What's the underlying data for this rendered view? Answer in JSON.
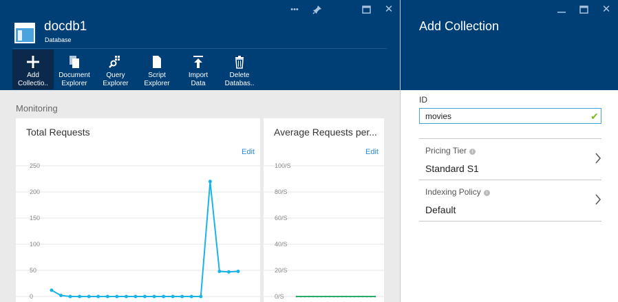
{
  "database_blade": {
    "title": "docdb1",
    "subtitle": "Database",
    "window_controls": [
      {
        "name": "more-icon",
        "glyph": "•••"
      },
      {
        "name": "pin-icon",
        "glyph": "📌"
      },
      {
        "name": "maximize-icon",
        "glyph": "□"
      },
      {
        "name": "close-icon",
        "glyph": "✕"
      }
    ],
    "toolbar": [
      {
        "label": "Add\nCollectio..",
        "icon": "plus-icon"
      },
      {
        "label": "Document\nExplorer",
        "icon": "documents-icon"
      },
      {
        "label": "Query\nExplorer",
        "icon": "query-icon"
      },
      {
        "label": "Script\nExplorer",
        "icon": "script-icon"
      },
      {
        "label": "Import\nData",
        "icon": "import-icon"
      },
      {
        "label": "Delete\nDatabas..",
        "icon": "trash-icon"
      }
    ],
    "section_title": "Monitoring",
    "tiles": [
      {
        "title": "Total Requests",
        "edit_label": "Edit"
      },
      {
        "title": "Average Requests per...",
        "edit_label": "Edit"
      }
    ]
  },
  "add_collection_blade": {
    "title": "Add Collection",
    "window_controls": [
      {
        "name": "minimize-icon",
        "glyph": "—"
      },
      {
        "name": "maximize-icon",
        "glyph": "□"
      },
      {
        "name": "close-icon",
        "glyph": "✕"
      }
    ],
    "id_label": "ID",
    "id_value": "movies",
    "pricing_tier_label": "Pricing Tier",
    "pricing_tier_value": "Standard S1",
    "indexing_policy_label": "Indexing Policy",
    "indexing_policy_value": "Default"
  },
  "colors": {
    "header": "#003f75",
    "accent": "#1ab3e8",
    "check": "#7cb919",
    "series_green": "#2aaa6b"
  },
  "chart_data": [
    {
      "type": "line",
      "title": "Total Requests",
      "yticks": [
        "250",
        "200",
        "150",
        "100",
        "50",
        "0"
      ],
      "ylim": [
        0,
        250
      ],
      "x": [
        1,
        2,
        3,
        4,
        5,
        6,
        7,
        8,
        9,
        10,
        11,
        12,
        13,
        14,
        15,
        16,
        17,
        18,
        19,
        20,
        21
      ],
      "values": [
        12,
        2,
        0,
        0,
        0,
        0,
        0,
        0,
        0,
        0,
        0,
        0,
        0,
        0,
        0,
        0,
        0,
        220,
        48,
        47,
        48
      ],
      "grid": true
    },
    {
      "type": "line",
      "title": "Average Requests per...",
      "yticks": [
        "100/S",
        "80/S",
        "60/S",
        "40/S",
        "20/S",
        "0/S"
      ],
      "ylim": [
        0,
        100
      ],
      "values": [
        0,
        0,
        0,
        0,
        0,
        0,
        0,
        0,
        0,
        0,
        0,
        0,
        0,
        0,
        0,
        0,
        0,
        0,
        0,
        0
      ],
      "grid": true
    }
  ]
}
